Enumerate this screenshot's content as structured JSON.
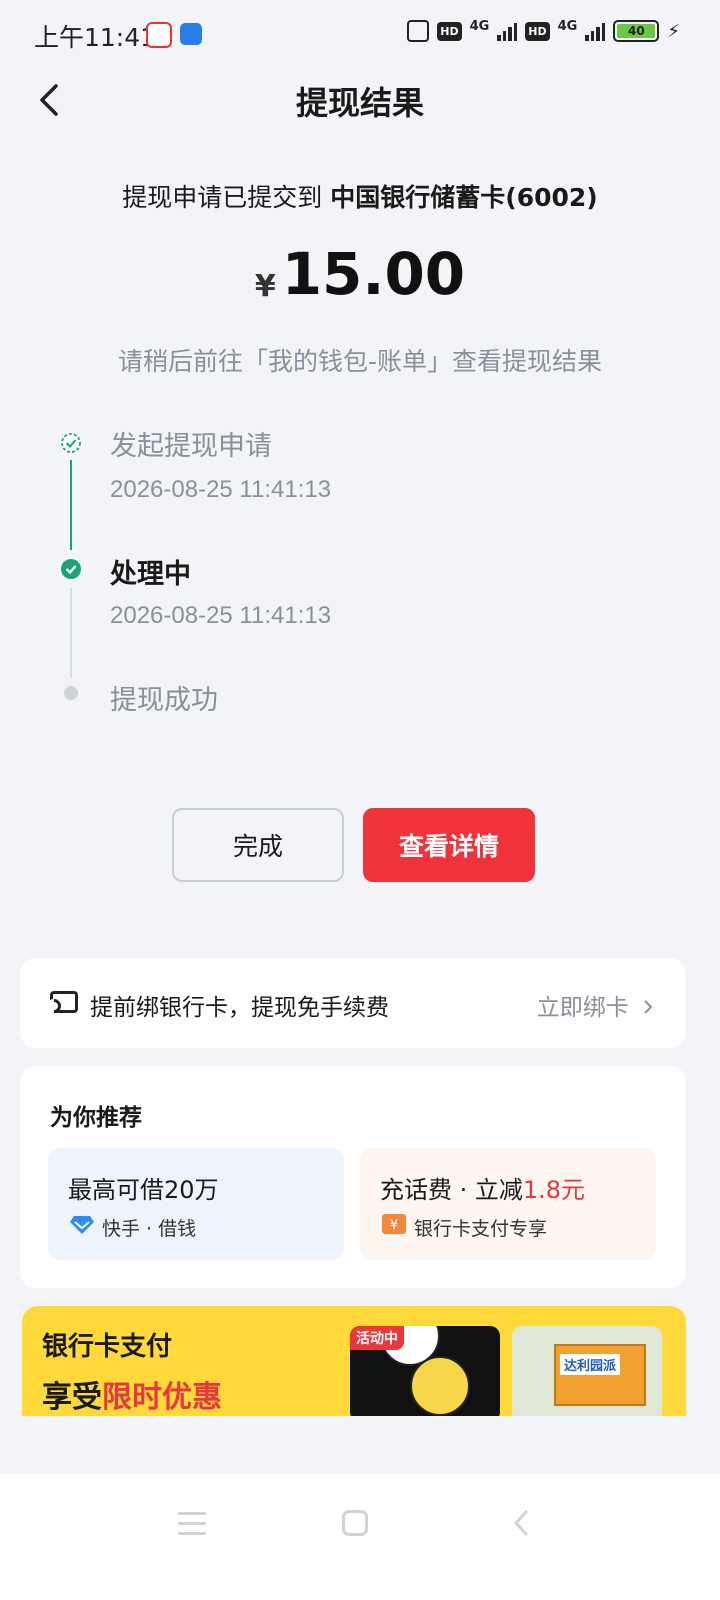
{
  "status_bar": {
    "time": "上午11:41",
    "network_1": "4G",
    "network_2": "4G",
    "hd_label": "HD",
    "battery": "40"
  },
  "header": {
    "title": "提现结果",
    "back_icon": "chevron-left-icon"
  },
  "result": {
    "submit_prefix": "提现申请已提交到",
    "bank_name": "中国银行储蓄卡(6002)",
    "currency_symbol": "¥",
    "amount": "15.00",
    "hint": "请稍后前往「我的钱包-账单」查看提现结果"
  },
  "timeline": [
    {
      "title": "发起提现申请",
      "time": "2026-08-25 11:41:13",
      "state": "done"
    },
    {
      "title": "处理中",
      "time": "2026-08-25 11:41:13",
      "state": "current"
    },
    {
      "title": "提现成功",
      "time": "",
      "state": "pending"
    }
  ],
  "buttons": {
    "done_label": "完成",
    "detail_label": "查看详情"
  },
  "bind_card": {
    "text": "提前绑银行卡，提现免手续费",
    "action": "立即绑卡",
    "icon": "ticket-icon"
  },
  "recommend": {
    "title": "为你推荐",
    "items": [
      {
        "main": "最高可借20万",
        "sub": "快手 · 借钱",
        "icon": "diamond-icon"
      },
      {
        "main_prefix": "充话费 · 立减",
        "main_highlight": "1.8元",
        "sub": "银行卡支付专享",
        "icon": "yuan-coupon-icon"
      }
    ]
  },
  "banner": {
    "line1": "银行卡支付",
    "line2_prefix": "享受",
    "line2_highlight": "限时优惠",
    "tag": "活动中",
    "product_label": "达利园派"
  },
  "colors": {
    "accent_red": "#f0323a",
    "success_green": "#1aa37a",
    "background": "#f3f4f8"
  }
}
